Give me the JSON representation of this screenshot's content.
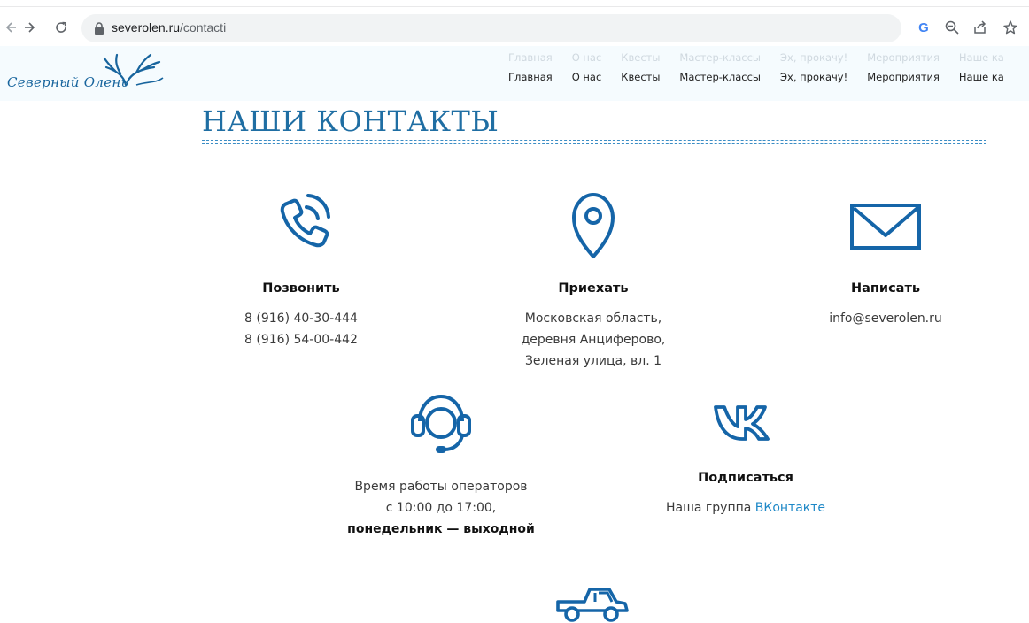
{
  "browser": {
    "url_host": "severolen.ru",
    "url_path": "/contacti",
    "google_letter": "G"
  },
  "header": {
    "logo_text": "Северный Олень",
    "menu": [
      {
        "label": "Главная"
      },
      {
        "label": "О нас"
      },
      {
        "label": "Квесты"
      },
      {
        "label": "Мастер-классы"
      },
      {
        "label": "Эх, прокачу!"
      },
      {
        "label": "Мероприятия"
      },
      {
        "label": "Наше ка"
      }
    ]
  },
  "page": {
    "title": "НАШИ КОНТАКТЫ"
  },
  "contacts": {
    "call": {
      "title": "Позвонить",
      "phones": [
        "8 (916) 40-30-444",
        "8 (916) 54-00-442"
      ]
    },
    "visit": {
      "title": "Приехать",
      "address": [
        "Московская область,",
        "деревня Анциферово,",
        "Зеленая улица, вл. 1"
      ]
    },
    "write": {
      "title": "Написать",
      "email": "info@severolen.ru"
    },
    "hours": {
      "line1": "Время работы операторов",
      "line2": "с 10:00 до 17:00,",
      "line3": "понедельник — выходной"
    },
    "vk": {
      "title": "Подписаться",
      "text": "Наша группа ",
      "link": "ВКонтакте"
    }
  },
  "colors": {
    "accent": "#1f6ea3",
    "icon": "#1565a8",
    "link": "#1e88c7",
    "header_bg": "#f5fbfe"
  },
  "icons": {
    "call": "phone-icon",
    "visit": "map-pin-icon",
    "write": "envelope-icon",
    "hours": "headset-icon",
    "vk": "vk-logo-icon",
    "delivery": "truck-icon"
  }
}
